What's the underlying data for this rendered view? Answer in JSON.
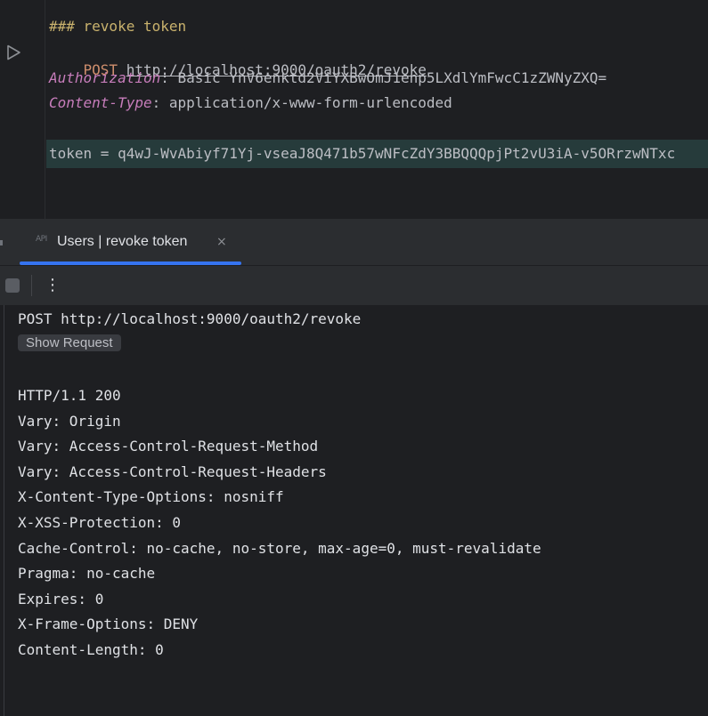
{
  "editor": {
    "comment": "### revoke token",
    "method": "POST",
    "url": "http://localhost:9000/oauth2/revoke",
    "headers": [
      {
        "name": "Authorization",
        "value": " Basic YnV6enktd2ViYXBwOmJ1enp5LXdlYmFwcC1zZWNyZXQ="
      },
      {
        "name": "Content-Type",
        "value": " application/x-www-form-urlencoded"
      }
    ],
    "body": "token = q4wJ-WvAbiyf71Yj-vseaJ8Q471b57wNFcZdY3BBQQQpjPt2vU3iA-v5ORrzwNTxc"
  },
  "tab": {
    "icon": "API",
    "label": "Users | revoke token",
    "close": "×"
  },
  "toolbar": {
    "more": "⋮"
  },
  "output": {
    "request_line": "POST http://localhost:9000/oauth2/revoke",
    "show_request": "Show Request",
    "status": "HTTP/1.1 200",
    "headers": [
      "Vary: Origin",
      "Vary: Access-Control-Request-Method",
      "Vary: Access-Control-Request-Headers",
      "X-Content-Type-Options: nosniff",
      "X-XSS-Protection: 0",
      "Cache-Control: no-cache, no-store, max-age=0, must-revalidate",
      "Pragma: no-cache",
      "Expires: 0",
      "X-Frame-Options: DENY",
      "Content-Length: 0"
    ]
  },
  "colors": {
    "accent": "#3574f0",
    "keyword": "#cf8e6d",
    "header_name": "#c77dbb",
    "comment": "#c9b26d"
  }
}
